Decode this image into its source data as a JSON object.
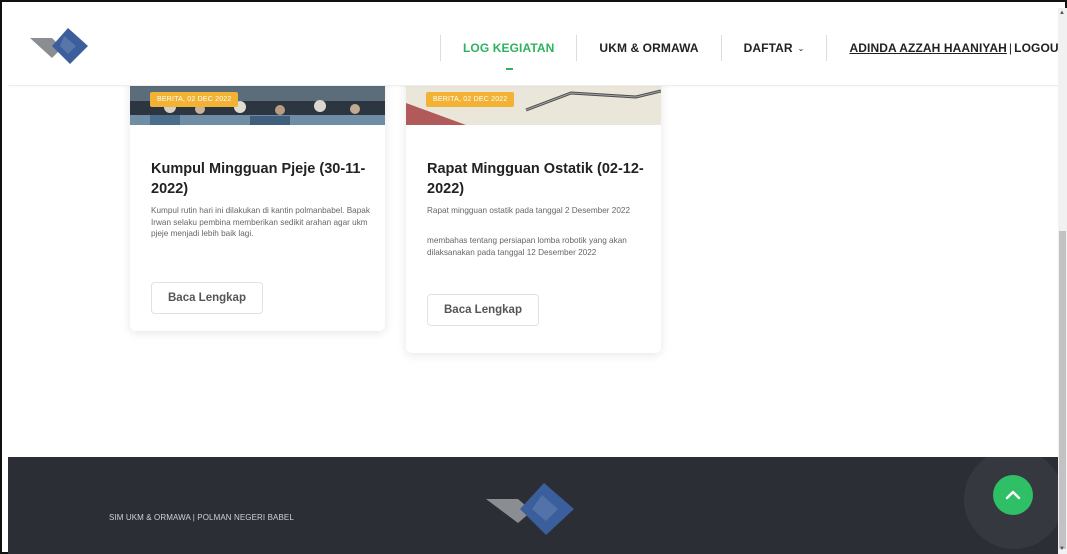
{
  "nav": {
    "log_kegiatan": "LOG KEGIATAN",
    "ukm_ormawa": "UKM & ORMAWA",
    "daftar": "DAFTAR",
    "user_name": "ADINDA AZZAH HAANIYAH",
    "separator": "|",
    "logout": "LOGOUT"
  },
  "cards": [
    {
      "badge": "BERITA, 02 DEC 2022",
      "title": "Kumpul Mingguan Pjeje (30-11-2022)",
      "paragraphs": [
        "Kumpul rutin hari ini dilakukan di kantin polmanbabel. Bapak Irwan selaku pembina memberikan sedikit arahan agar ukm pjeje menjadi lebih baik lagi."
      ],
      "button": "Baca Lengkap"
    },
    {
      "badge": "BERITA, 02 DEC 2022",
      "title": "Rapat Mingguan Ostatik (02-12-2022)",
      "paragraphs": [
        "Rapat mingguan ostatik pada tanggal 2 Desember 2022",
        "membahas tentang persiapan lomba robotik yang akan dilaksanakan pada tanggal 12 Desember 2022"
      ],
      "button": "Baca Lengkap"
    }
  ],
  "footer": {
    "text": "SIM UKM & ORMAWA | POLMAN NEGERI BABEL"
  },
  "icons": {
    "logo": "diamond-logo-icon",
    "back_to_top": "chevron-up-icon",
    "dropdown": "chevron-down-icon"
  },
  "colors": {
    "accent_green": "#2db35d",
    "badge_orange": "#f2b233",
    "footer_bg": "#2b2e34",
    "logo_blue": "#3b5f9c",
    "logo_grey": "#8a8d92"
  }
}
